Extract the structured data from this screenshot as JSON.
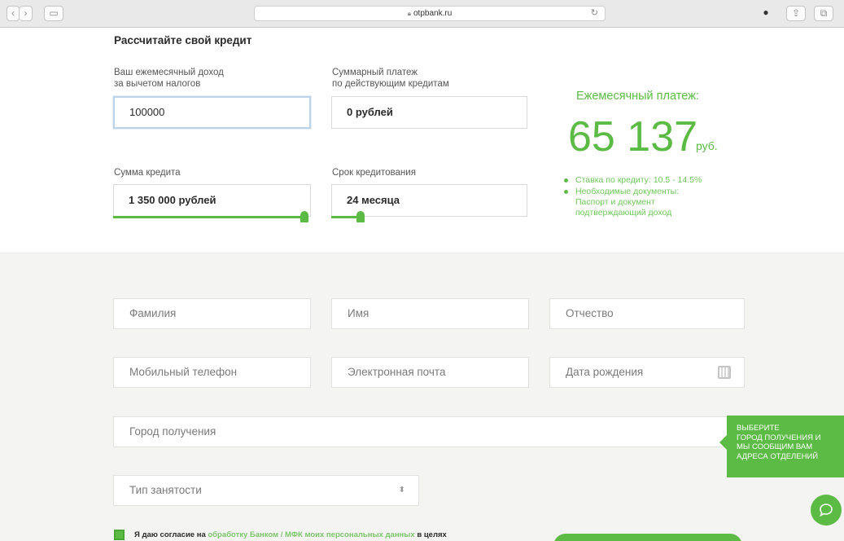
{
  "browser": {
    "url": "otpbank.ru"
  },
  "calculator": {
    "title": "Рассчитайте свой кредит",
    "income": {
      "label_line1": "Ваш ежемесячный доход",
      "label_line2": "за вычетом налогов",
      "value": "100000"
    },
    "other_payments": {
      "label_line1": "Суммарный платеж",
      "label_line2": "по действующим кредитам",
      "value": "0 рублей"
    },
    "loan_amount": {
      "label": "Сумма кредита",
      "value": "1 350 000 рублей",
      "slider_fraction": 1.0
    },
    "loan_term": {
      "label": "Срок кредитования",
      "value": "24 месяца",
      "slider_fraction": 0.17
    },
    "result": {
      "title": "Ежемесячный платеж:",
      "amount": "65 137",
      "unit": "руб.",
      "bullets": [
        "Ставка по кредиту: 10.5 - 14.5%",
        "Необходимые документы:",
        "Паспорт и документ",
        "подтверждающий доход"
      ]
    }
  },
  "form": {
    "last_name_placeholder": "Фамилия",
    "first_name_placeholder": "Имя",
    "patronymic_placeholder": "Отчество",
    "phone_placeholder": "Мобильный телефон",
    "email_placeholder": "Электронная почта",
    "birthdate_placeholder": "Дата рождения",
    "city_placeholder": "Город получения",
    "employment_placeholder": "Тип занятости",
    "tooltip_lines": [
      "Выберите",
      "город получения и",
      "мы сообщим вам",
      "адреса отделений"
    ],
    "consent_before": "Я даю согласие на",
    "consent_link": "обработку Банком / МФК моих персональных данных",
    "consent_after": "в целях"
  },
  "colors": {
    "accent": "#5cbb45"
  }
}
